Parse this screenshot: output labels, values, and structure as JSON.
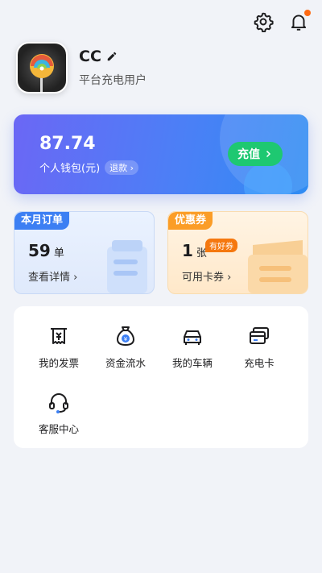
{
  "header": {
    "settings_icon": "gear-icon",
    "notify_icon": "bell-icon"
  },
  "profile": {
    "name": "CC",
    "role": "平台充电用户"
  },
  "wallet": {
    "balance": "87.74",
    "label": "个人钱包(元)",
    "refund_label": "退款",
    "recharge_label": "充值"
  },
  "orders": {
    "tag": "本月订单",
    "count": "59",
    "unit": "单",
    "link": "查看详情"
  },
  "coupons": {
    "tag": "优惠券",
    "count": "1",
    "unit": "张",
    "badge": "有好券",
    "link": "可用卡券"
  },
  "menu": [
    {
      "label": "我的发票",
      "icon": "invoice-icon"
    },
    {
      "label": "资金流水",
      "icon": "money-bag-icon"
    },
    {
      "label": "我的车辆",
      "icon": "car-icon"
    },
    {
      "label": "充电卡",
      "icon": "card-icon"
    },
    {
      "label": "客服中心",
      "icon": "headset-icon"
    }
  ],
  "colors": {
    "accent": "#4c7ff6",
    "recharge": "#1ec871",
    "coupon": "#fb9d27",
    "notify_dot": "#ff6a13"
  }
}
